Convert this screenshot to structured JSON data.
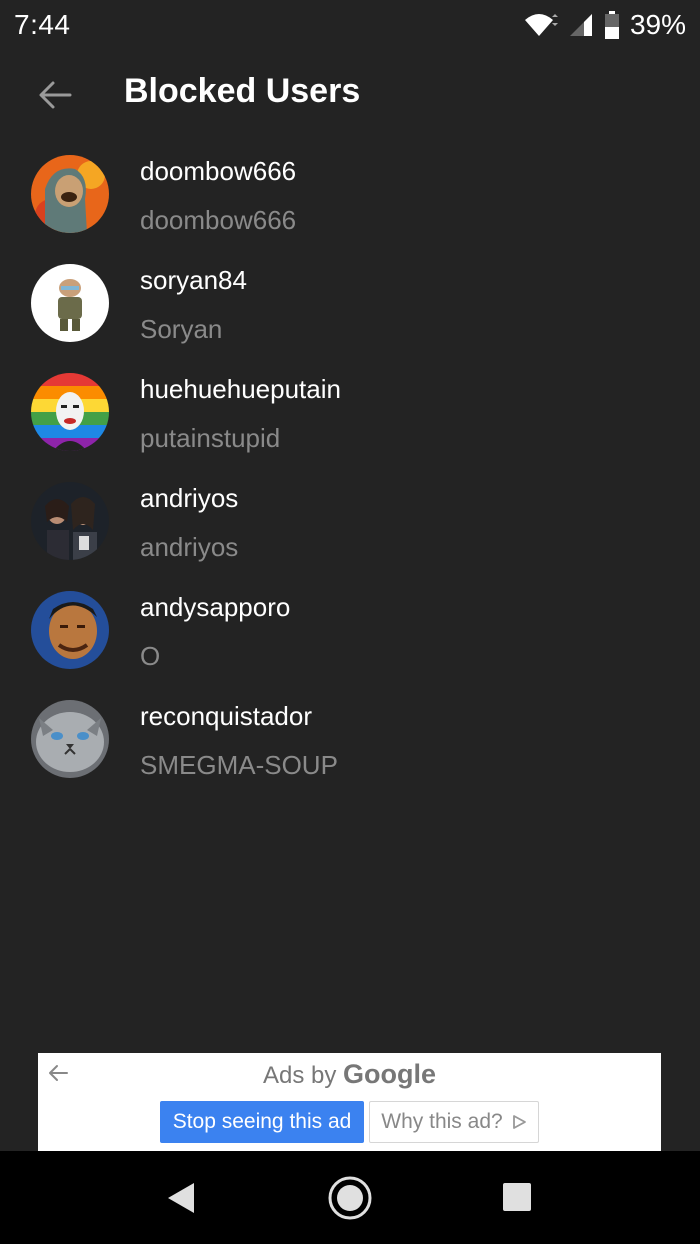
{
  "status": {
    "time": "7:44",
    "battery": "39%",
    "icons": [
      "wifi-icon",
      "cell-signal-icon",
      "battery-icon"
    ]
  },
  "header": {
    "title": "Blocked Users",
    "back_icon": "arrow-back-icon"
  },
  "users": [
    {
      "username": "doombow666",
      "display_name": "doombow666"
    },
    {
      "username": "soryan84",
      "display_name": "Soryan"
    },
    {
      "username": "huehuehueputain",
      "display_name": "putainstupid"
    },
    {
      "username": "andriyos",
      "display_name": "andriyos"
    },
    {
      "username": "andysapporo",
      "display_name": "O"
    },
    {
      "username": "reconquistador",
      "display_name": "SMEGMA-SOUP"
    }
  ],
  "ad": {
    "ads_by": "Ads by",
    "brand": "Google",
    "stop_label": "Stop seeing this ad",
    "why_label": "Why this ad?"
  },
  "colors": {
    "background": "#232323",
    "secondary_text": "#8a8a8a",
    "ad_button": "#3b82f0"
  }
}
